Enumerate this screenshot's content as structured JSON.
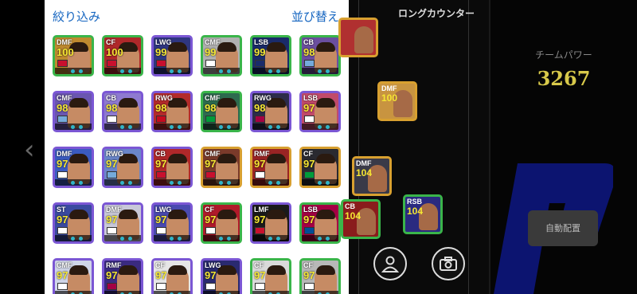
{
  "panel": {
    "filter_label": "絞り込み",
    "sort_label": "並び替え"
  },
  "left_nav": {
    "chevron": "‹"
  },
  "players": [
    {
      "pos": "DMF",
      "rating": "100",
      "color": "#3ab54a",
      "bg": "#bf8a2f",
      "flag": "#c8102e"
    },
    {
      "pos": "CF",
      "rating": "100",
      "color": "#3ab54a",
      "bg": "#b0282a",
      "flag": "#c8102e"
    },
    {
      "pos": "LWG",
      "rating": "99",
      "color": "#7b57d4",
      "bg": "#2f3680",
      "flag": "#c8102e"
    },
    {
      "pos": "CMF",
      "rating": "99",
      "color": "#3ab54a",
      "bg": "#b0b0b0",
      "flag": "#ffffff"
    },
    {
      "pos": "LSB",
      "rating": "99",
      "color": "#3ab54a",
      "bg": "#1a2b6a",
      "flag": "#1a2b6a"
    },
    {
      "pos": "CB",
      "rating": "98",
      "color": "#3ab54a",
      "bg": "#6b4fa0",
      "flag": "#75aadb"
    },
    {
      "pos": "CMF",
      "rating": "98",
      "color": "#7b57d4",
      "bg": "#6a56b0",
      "flag": "#75aadb"
    },
    {
      "pos": "CB",
      "rating": "98",
      "color": "#7b57d4",
      "bg": "#8e7ad0",
      "flag": "#ffffff"
    },
    {
      "pos": "RWG",
      "rating": "98",
      "color": "#7b57d4",
      "bg": "#b32b2b",
      "flag": "#c60b1e"
    },
    {
      "pos": "CMF",
      "rating": "98",
      "color": "#3ab54a",
      "bg": "#2d6b4f",
      "flag": "#009c3b"
    },
    {
      "pos": "RWG",
      "rating": "98",
      "color": "#7b57d4",
      "bg": "#2c2c4a",
      "flag": "#a50044"
    },
    {
      "pos": "LSB",
      "rating": "97",
      "color": "#7b57d4",
      "bg": "#c14a6a",
      "flag": "#ffffff"
    },
    {
      "pos": "DMF",
      "rating": "97",
      "color": "#7b57d4",
      "bg": "#3b5bc0",
      "flag": "#ffffff"
    },
    {
      "pos": "RWG",
      "rating": "97",
      "color": "#7b57d4",
      "bg": "#6a86c9",
      "flag": "#75aadb"
    },
    {
      "pos": "CB",
      "rating": "97",
      "color": "#7b57d4",
      "bg": "#b0282a",
      "flag": "#c8102e"
    },
    {
      "pos": "CMF",
      "rating": "97",
      "color": "#d8a030",
      "bg": "#7a3a2a",
      "flag": "#c8102e"
    },
    {
      "pos": "RMF",
      "rating": "97",
      "color": "#d8a030",
      "bg": "#9a2424",
      "flag": "#ffffff"
    },
    {
      "pos": "CF",
      "rating": "97",
      "color": "#d8a030",
      "bg": "#2a2a30",
      "flag": "#009c3b"
    },
    {
      "pos": "ST",
      "rating": "97",
      "color": "#7b57d4",
      "bg": "#3a4aa0",
      "flag": "#ffffff"
    },
    {
      "pos": "DMF",
      "rating": "97",
      "color": "#7b57d4",
      "bg": "#c8c8d8",
      "flag": "#ffffff"
    },
    {
      "pos": "LWG",
      "rating": "97",
      "color": "#7b57d4",
      "bg": "#4a4ab0",
      "flag": "#ffffff"
    },
    {
      "pos": "CF",
      "rating": "97",
      "color": "#3ab54a",
      "bg": "#b01a2a",
      "flag": "#ffffff"
    },
    {
      "pos": "LMF",
      "rating": "97",
      "color": "#7b57d4",
      "bg": "#1a1a1a",
      "flag": "#c8102e"
    },
    {
      "pos": "LSB",
      "rating": "97",
      "color": "#3ab54a",
      "bg": "#a50044",
      "flag": "#004d98"
    },
    {
      "pos": "CMF",
      "rating": "97",
      "color": "#7b57d4",
      "bg": "#d0d6e8",
      "flag": "#ffffff"
    },
    {
      "pos": "RMF",
      "rating": "97",
      "color": "#7b57d4",
      "bg": "#3a2a80",
      "flag": "#a50044"
    },
    {
      "pos": "CF",
      "rating": "97",
      "color": "#7b57d4",
      "bg": "#e6e6e6",
      "flag": "#ffffff"
    },
    {
      "pos": "LWG",
      "rating": "97",
      "color": "#7b57d4",
      "bg": "#2a2a70",
      "flag": "#ffffff"
    },
    {
      "pos": "CF",
      "rating": "97",
      "color": "#3ab54a",
      "bg": "#dadada",
      "flag": "#ffffff"
    },
    {
      "pos": "CF",
      "rating": "97",
      "color": "#3ab54a",
      "bg": "#b8b8b8",
      "flag": "#ffffff"
    }
  ],
  "pitch": {
    "counter_title": "ロングカウンター",
    "cards": [
      {
        "pos": "",
        "rating": "",
        "color": "#d8a030",
        "bg": "#b03030"
      },
      {
        "pos": "DMF",
        "rating": "100",
        "color": "#d8a030",
        "bg": "#c89440"
      },
      {
        "pos": "DMF",
        "rating": "104",
        "color": "#d8a030",
        "bg": "#3a3a48"
      },
      {
        "pos": "RSB",
        "rating": "104",
        "color": "#3ab54a",
        "bg": "#2a2a80"
      },
      {
        "pos": "CB",
        "rating": "104",
        "color": "#3ab54a",
        "bg": "#8a1c1c"
      }
    ]
  },
  "sidebar": {
    "power_label": "チームパワー",
    "power_value": "3267",
    "auto_button": "自動配置"
  },
  "icons": {
    "person": "person-icon",
    "camera": "camera-icon"
  }
}
